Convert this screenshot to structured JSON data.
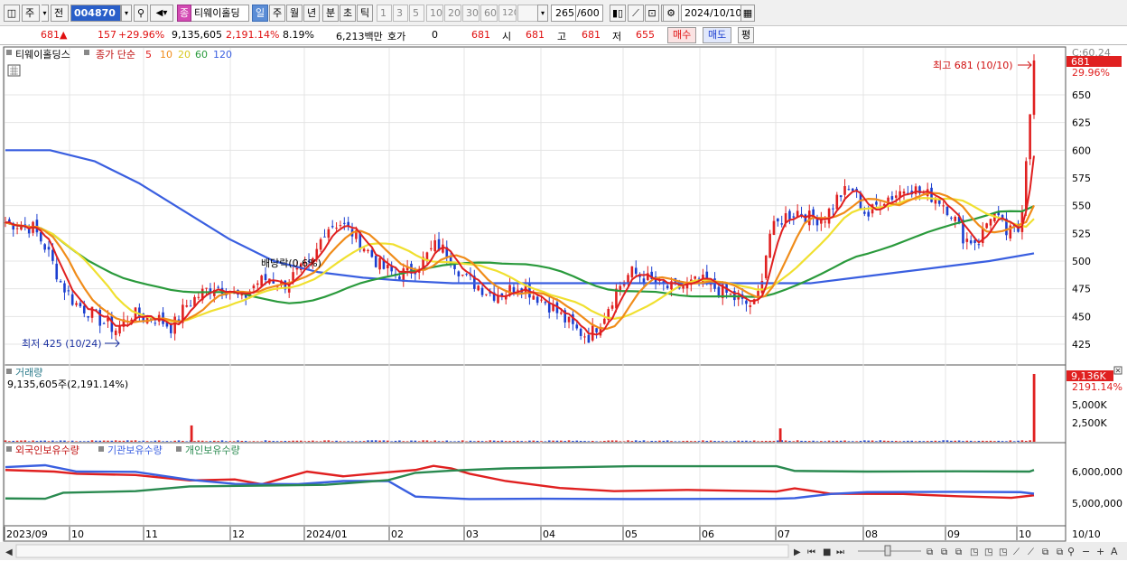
{
  "toolbar": {
    "mode_label": "주",
    "prev_label": "전",
    "stock_code": "004870",
    "stock_name": "티웨이홀딩",
    "stock_badge": "종",
    "periods": [
      "일",
      "주",
      "월",
      "년",
      "분",
      "초",
      "틱"
    ],
    "active_period": "일",
    "intervals": [
      "1",
      "3",
      "5",
      "10",
      "20",
      "30",
      "60",
      "120"
    ],
    "count_display": "265",
    "count_total": "/600",
    "date_value": "2024/10/10"
  },
  "quote": {
    "price": "681",
    "up_arrow": "▲",
    "change": "157",
    "change_pct": "+29.96%",
    "volume": "9,135,605",
    "volume_ratio": "2,191.14%",
    "turnover_pct": "8.19%",
    "amount": "6,213백만",
    "hoga_label": "호가",
    "hoga_value": "0",
    "ask_price": "681",
    "open_label": "시",
    "open": "681",
    "high_label": "고",
    "high": "681",
    "low_label": "저",
    "low": "655",
    "buy_label": "매수",
    "sell_label": "매도",
    "avg_label": "평"
  },
  "price_panel": {
    "stock_label": "티웨이홀딩스",
    "ma_label": "종가 단순",
    "ma_periods": [
      "5",
      "10",
      "20",
      "60",
      "120"
    ],
    "ma_colors": [
      "#e02020",
      "#f08c1a",
      "#f0e030",
      "#2a9a3c",
      "#3a5fe0"
    ],
    "top_label": "C:60.24",
    "price_tag": "681",
    "pct_tag": "29.96%",
    "high_annotation": "최고 681 (10/10)",
    "low_annotation": "최저 425 (10/24)",
    "dividend_annotation": "배당락(0.6%)",
    "axis_ticks": [
      "650",
      "625",
      "600",
      "575",
      "550",
      "525",
      "500",
      "475",
      "450",
      "425"
    ]
  },
  "volume_panel": {
    "title": "거래량",
    "value_text": "9,135,605주(2,191.14%)",
    "tag": "9,136K",
    "tag_pct": "2191.14%",
    "axis_ticks": [
      "5,000K",
      "2,500K"
    ]
  },
  "holding_panel": {
    "series_labels": [
      "외국인보유수량",
      "기관보유수량",
      "개인보유수량"
    ],
    "series_colors": [
      "#e02020",
      "#3a5fe0",
      "#2a8a50"
    ],
    "axis_ticks": [
      "6,000,000",
      "5,000,000"
    ]
  },
  "x_axis": {
    "labels": [
      "2023/09",
      "10",
      "11",
      "12",
      "2024/01",
      "02",
      "03",
      "04",
      "05",
      "06",
      "07",
      "08",
      "09",
      "10"
    ],
    "end_label": "10/10"
  },
  "chart_data": {
    "type": "candlestick",
    "ylim": [
      415,
      690
    ],
    "axis_ticks": [
      650,
      625,
      600,
      575,
      550,
      525,
      500,
      475,
      450,
      425
    ],
    "high_point": {
      "value": 681,
      "date": "10/10"
    },
    "low_point": {
      "value": 425,
      "date": "10/24"
    },
    "ohlc_anchor_closes": [
      535,
      533,
      530,
      510,
      480,
      462,
      455,
      445,
      438,
      452,
      450,
      448,
      440,
      460,
      470,
      478,
      475,
      465,
      480,
      485,
      478,
      490,
      495,
      530,
      535,
      525,
      510,
      495,
      488,
      490,
      500,
      515,
      505,
      485,
      478,
      470,
      472,
      480,
      470,
      462,
      450,
      438,
      432,
      450,
      475,
      490,
      485,
      478,
      475,
      478,
      482,
      476,
      470,
      462,
      460,
      525,
      540,
      545,
      538,
      540,
      560,
      565,
      540,
      555,
      560,
      568,
      560,
      558,
      545,
      520,
      518,
      545,
      525,
      528,
      681
    ],
    "moving_averages": {
      "ma5": [
        540,
        535,
        510,
        475,
        450,
        445,
        455,
        470,
        475,
        480,
        485,
        525,
        515,
        495,
        490,
        502,
        490,
        478,
        470,
        455,
        435,
        450,
        485,
        480,
        475,
        480,
        470,
        460,
        530,
        545,
        540,
        560,
        550,
        565,
        560,
        545,
        520,
        530,
        548
      ],
      "ma120": [
        600,
        600,
        590,
        570,
        545,
        520,
        500,
        490,
        485,
        482,
        480,
        480,
        480,
        480,
        480,
        480,
        480,
        480,
        480,
        485,
        490,
        495,
        500,
        507
      ]
    },
    "volume_spikes": [
      {
        "date": "2023/11",
        "value": 2200
      },
      {
        "date": "2024/07",
        "value": 1800
      },
      {
        "date": "2024/10/10",
        "value": 9136
      }
    ]
  }
}
